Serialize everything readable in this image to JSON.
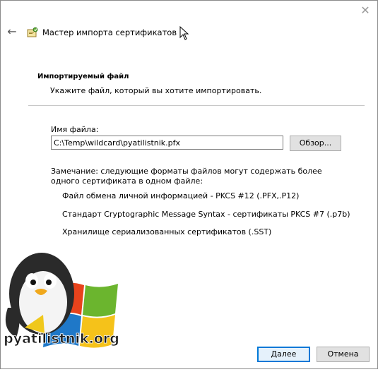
{
  "window": {
    "title": "Мастер импорта сертификатов",
    "close_glyph": "✕",
    "back_glyph": "←"
  },
  "section": {
    "heading": "Импортируемый файл",
    "description": "Укажите файл, который вы хотите импортировать."
  },
  "file": {
    "label": "Имя файла:",
    "value": "C:\\Temp\\wildcard\\pyatilistnik.pfx",
    "browse_label": "Обзор..."
  },
  "note": {
    "text": "Замечание: следующие форматы файлов могут содержать более одного сертификата в одном файле:",
    "formats": [
      "Файл обмена личной информацией - PKCS #12 (.PFX,.P12)",
      "Стандарт Cryptographic Message Syntax - сертификаты PKCS #7 (.p7b)",
      "Хранилище сериализованных сертификатов (.SST)"
    ]
  },
  "logo": {
    "text": "pyatilistnik.org"
  },
  "footer": {
    "next_label": "Далее",
    "cancel_label": "Отмена"
  },
  "colors": {
    "accent": "#0078d7",
    "divider": "#c8c8c8"
  }
}
